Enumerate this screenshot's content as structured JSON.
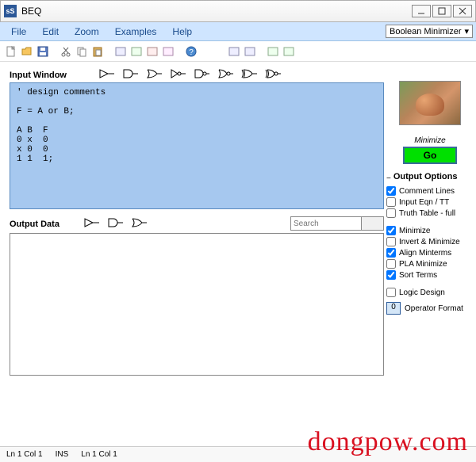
{
  "window": {
    "app_icon_text": "sS",
    "title": "BEQ"
  },
  "menu": {
    "file": "File",
    "edit": "Edit",
    "zoom": "Zoom",
    "examples": "Examples",
    "help": "Help",
    "mode": "Boolean Minimizer"
  },
  "sections": {
    "input_label": "Input Window",
    "output_label": "Output Data"
  },
  "input_text": "' design comments\n\nF = A or B;\n\nA B  F\n0 x  0\nx 0  0\n1 1  1;",
  "search": {
    "placeholder": "Search"
  },
  "right": {
    "minimize_label": "Minimize",
    "go_label": "Go"
  },
  "options": {
    "title": "Output Options",
    "comment_lines": {
      "label": "Comment Lines",
      "checked": true
    },
    "input_eqn_tt": {
      "label": "Input Eqn / TT",
      "checked": false
    },
    "truth_table_full": {
      "label": "Truth Table - full",
      "checked": false
    },
    "minimize": {
      "label": "Minimize",
      "checked": true
    },
    "invert_minimize": {
      "label": "Invert & Minimize",
      "checked": false
    },
    "align_minterms": {
      "label": "Align Minterms",
      "checked": true
    },
    "pla_minimize": {
      "label": "PLA Minimize",
      "checked": false
    },
    "sort_terms": {
      "label": "Sort Terms",
      "checked": true
    },
    "logic_design": {
      "label": "Logic Design",
      "checked": false
    },
    "operator_format": {
      "label": "Operator Format",
      "value": "0"
    }
  },
  "status": {
    "line_col_1": "Ln 1  Col 1",
    "ins": "INS",
    "line_col_2": "Ln 1  Col 1"
  },
  "watermark": "dongpow.com"
}
